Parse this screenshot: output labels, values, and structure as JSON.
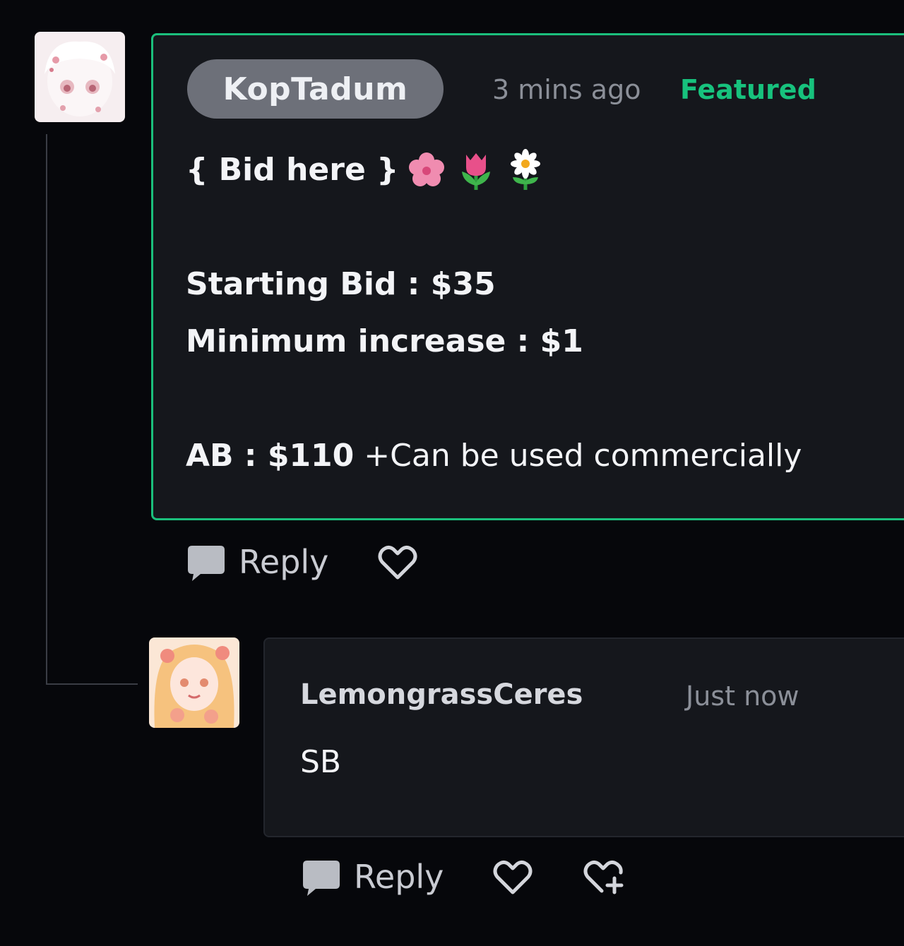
{
  "comments": [
    {
      "author": "KopTadum",
      "time": "3 mins ago",
      "badge": "Featured",
      "avatar": "avatar-image",
      "body": {
        "line1": "{ Bid here }",
        "line1_emoji": [
          "cherry-blossom",
          "tulip",
          "daisy"
        ],
        "line2": "Starting Bid : $35",
        "line3": "Minimum increase : $1",
        "line4_bold": "AB : $110",
        "line4_normal": "+Can be used commercially"
      },
      "actions": {
        "reply_label": "Reply"
      }
    },
    {
      "author": "LemongrassCeres",
      "time": "Just now",
      "avatar": "avatar-image",
      "body": "SB",
      "actions": {
        "reply_label": "Reply"
      }
    }
  ],
  "icons": {
    "reply": "comment-bubble-icon",
    "like": "heart-icon",
    "award": "heart-plus-icon"
  },
  "colors": {
    "background": "#06070b",
    "card": "#15171c",
    "featured_border": "#1bbf7c",
    "featured_text": "#17c27d",
    "muted_text": "#8b8f98",
    "author_pill": "#6d7079"
  }
}
